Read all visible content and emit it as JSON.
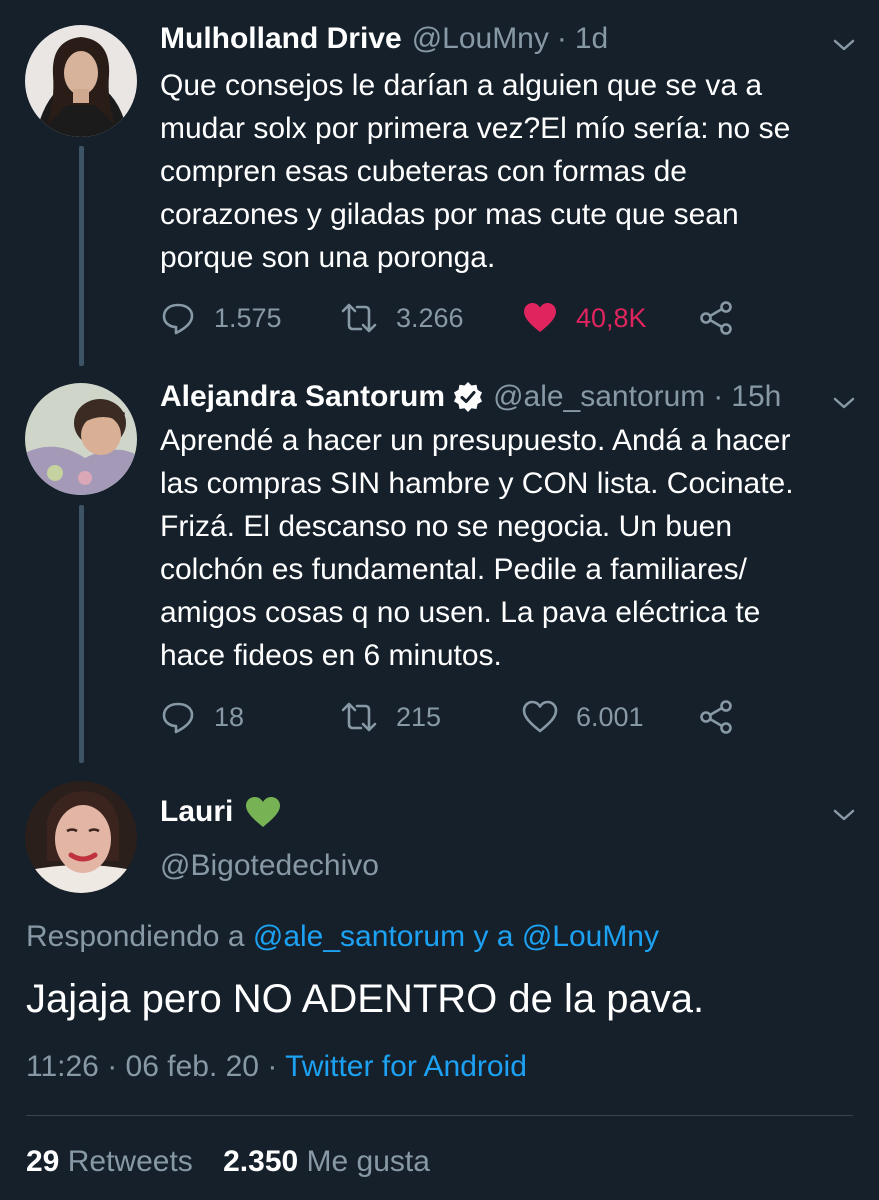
{
  "thread": [
    {
      "name": "Mulholland Drive",
      "handle": "@LouMny",
      "age": "1d",
      "lines": [
        "Que consejos le darían a alguien que se va a",
        "mudar solx por primera vez?El mío sería: no se",
        "compren esas cubeteras con formas de",
        "corazones y giladas por mas cute que sean",
        "porque son una poronga."
      ],
      "replies": "1.575",
      "retweets": "3.266",
      "likes": "40,8K",
      "liked": true
    },
    {
      "name": "Alejandra Santorum",
      "verified": true,
      "handle": "@ale_santorum",
      "age": "15h",
      "lines": [
        "Aprendé a hacer un presupuesto. Andá a hacer",
        "las compras SIN hambre y CON lista. Cocinate.",
        "Frizá. El descanso no se negocia. Un buen",
        "colchón es fundamental. Pedile a familiares/",
        "amigos cosas q no usen. La pava eléctrica te",
        "hace fideos en 6 minutos."
      ],
      "replies": "18",
      "retweets": "215",
      "likes": "6.001",
      "liked": false
    }
  ],
  "main": {
    "name": "Lauri",
    "name_emoji": "green-heart-icon",
    "handle": "@Bigotedechivo",
    "replying_prefix": "Respondiendo a",
    "replying_user1": "@ale_santorum",
    "replying_and": "y a",
    "replying_user2": "@LouMny",
    "text": "Jajaja pero NO ADENTRO de la pava.",
    "time": "11:26",
    "date": "06 feb. 20",
    "source": "Twitter for Android",
    "retweet_count": "29",
    "retweet_label": "Retweets",
    "like_count": "2.350",
    "like_label": "Me gusta"
  },
  "colors": {
    "background": "#15202b",
    "secondary_text": "#8899a6",
    "link": "#1da1f2",
    "like": "#e0245e",
    "heart_emoji": "#77b255"
  }
}
